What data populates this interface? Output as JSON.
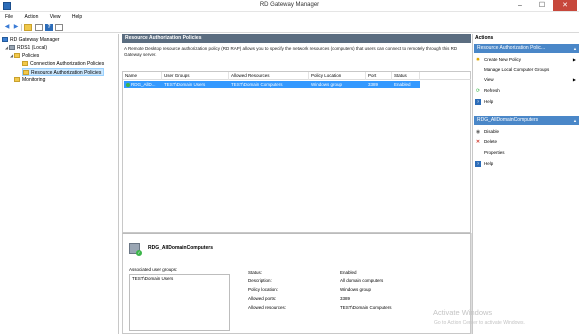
{
  "window": {
    "title": "RD Gateway Manager",
    "minimize": "–",
    "maximize": "☐",
    "close": "✕"
  },
  "menu": [
    "File",
    "Action",
    "View",
    "Help"
  ],
  "tree": {
    "root": "RD Gateway Manager",
    "server": "RDS1 (Local)",
    "policies": "Policies",
    "cap": "Connection Authorization Policies",
    "rap": "Resource Authorization Policies",
    "monitoring": "Monitoring"
  },
  "center": {
    "header": "Resource Authorization Policies",
    "description": "A Remote Desktop resource authorization policy (RD RAP) allows you to specify the network resources (computers) that users can connect to remotely through this RD Gateway server.",
    "columns": [
      "Name",
      "User Groups",
      "Allowed Resources",
      "Policy Location",
      "Port",
      "Status"
    ],
    "rows": [
      {
        "name": "RDG_AllD...",
        "user_groups": "TEST\\Domain Users",
        "allowed_resources": "TEST\\Domain Computers",
        "policy_location": "Windows group",
        "port": "3389",
        "status": "Enabled"
      }
    ]
  },
  "detail": {
    "title": "RDG_AllDomainComputers",
    "assoc_label": "Associated user groups:",
    "assoc_groups": [
      "TEST\\Domain Users"
    ],
    "props": [
      {
        "label": "Status:",
        "value": "Enabled"
      },
      {
        "label": "Description:",
        "value": "All domain computers"
      },
      {
        "label": "Policy location:",
        "value": "Windows group"
      },
      {
        "label": "Allowed ports:",
        "value": "3389"
      },
      {
        "label": "Allowed resources:",
        "value": "TEST\\Domain Computers"
      }
    ]
  },
  "actions": {
    "title": "Actions",
    "section1": "Resource Authorization Polic...",
    "items1": [
      "Create New Policy",
      "Manage Local Computer Groups",
      "View",
      "Refresh",
      "Help"
    ],
    "section2": "RDG_AllDomainComputers",
    "items2": [
      "Disable",
      "Delete",
      "Properties",
      "Help"
    ]
  },
  "watermark": {
    "line1": "Activate Windows",
    "line2": "Go to Action Center to activate Windows."
  }
}
